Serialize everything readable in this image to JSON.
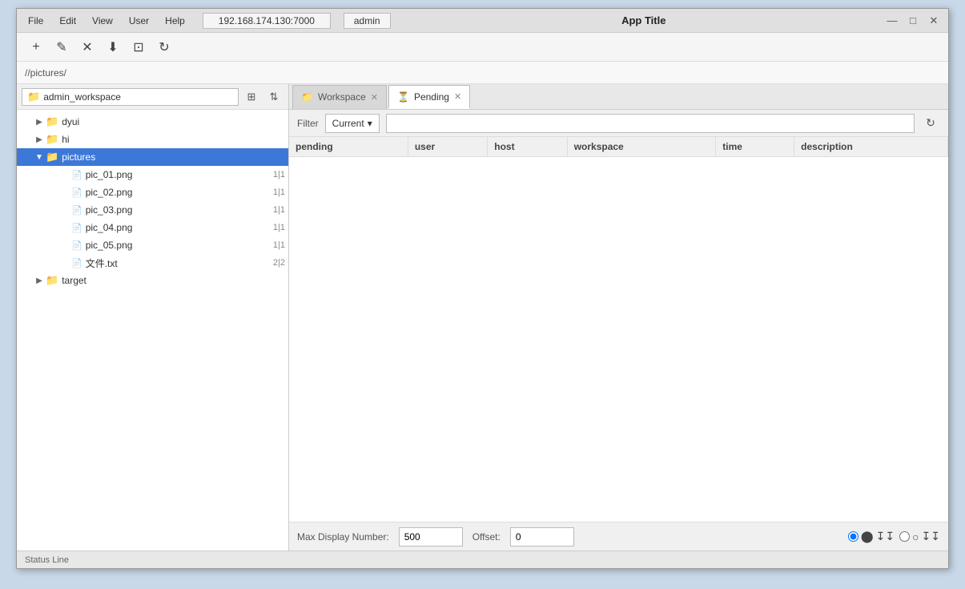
{
  "titlebar": {
    "menu": [
      "File",
      "Edit",
      "View",
      "User",
      "Help"
    ],
    "tab1": "192.168.174.130:7000",
    "tab2": "admin",
    "title": "App Title",
    "minimize": "—",
    "maximize": "□",
    "close": "✕"
  },
  "toolbar": {
    "add": "+",
    "edit": "✎",
    "close": "✕",
    "download": "⬇",
    "save": "⊡",
    "refresh": "↻"
  },
  "pathbar": {
    "path": "//pictures/"
  },
  "workspace": {
    "name": "admin_workspace",
    "sort_icon": "⇅",
    "new_icon": "⊞"
  },
  "tree": {
    "items": [
      {
        "id": "dyui",
        "label": "dyui",
        "type": "folder",
        "indent": 1,
        "expanded": false,
        "arrow": "▶"
      },
      {
        "id": "hi",
        "label": "hi",
        "type": "folder",
        "indent": 1,
        "expanded": false,
        "arrow": "▶"
      },
      {
        "id": "pictures",
        "label": "pictures",
        "type": "folder",
        "indent": 1,
        "expanded": true,
        "arrow": "▼",
        "selected": true
      },
      {
        "id": "pic_01",
        "label": "pic_01.png",
        "type": "file",
        "indent": 2,
        "badge": "1|1"
      },
      {
        "id": "pic_02",
        "label": "pic_02.png",
        "type": "file",
        "indent": 2,
        "badge": "1|1"
      },
      {
        "id": "pic_03",
        "label": "pic_03.png",
        "type": "file",
        "indent": 2,
        "badge": "1|1"
      },
      {
        "id": "pic_04",
        "label": "pic_04.png",
        "type": "file",
        "indent": 2,
        "badge": "1|1"
      },
      {
        "id": "pic_05",
        "label": "pic_05.png",
        "type": "file",
        "indent": 2,
        "badge": "1|1"
      },
      {
        "id": "text_file",
        "label": "文件.txt",
        "type": "file",
        "indent": 2,
        "badge": "2|2"
      },
      {
        "id": "target",
        "label": "target",
        "type": "folder",
        "indent": 1,
        "expanded": false,
        "arrow": "▶"
      }
    ]
  },
  "tabs": [
    {
      "id": "workspace",
      "label": "Workspace",
      "icon": "📁",
      "active": false
    },
    {
      "id": "pending",
      "label": "Pending",
      "icon": "⏳",
      "active": true
    }
  ],
  "filter": {
    "label": "Filter",
    "option": "Current",
    "dropdown": "▾",
    "search_placeholder": "",
    "refresh_icon": "↻"
  },
  "table": {
    "columns": [
      "pending",
      "user",
      "host",
      "workspace",
      "time",
      "description"
    ],
    "rows": []
  },
  "bottom": {
    "max_label": "Max Display Number:",
    "max_value": "500",
    "offset_label": "Offset:",
    "offset_value": "0",
    "radio1_icon": "⬤",
    "radio1_suffix": "↧↧",
    "radio2_icon": "○",
    "radio2_suffix": "↧↧"
  },
  "statusbar": {
    "text": "Status Line"
  }
}
